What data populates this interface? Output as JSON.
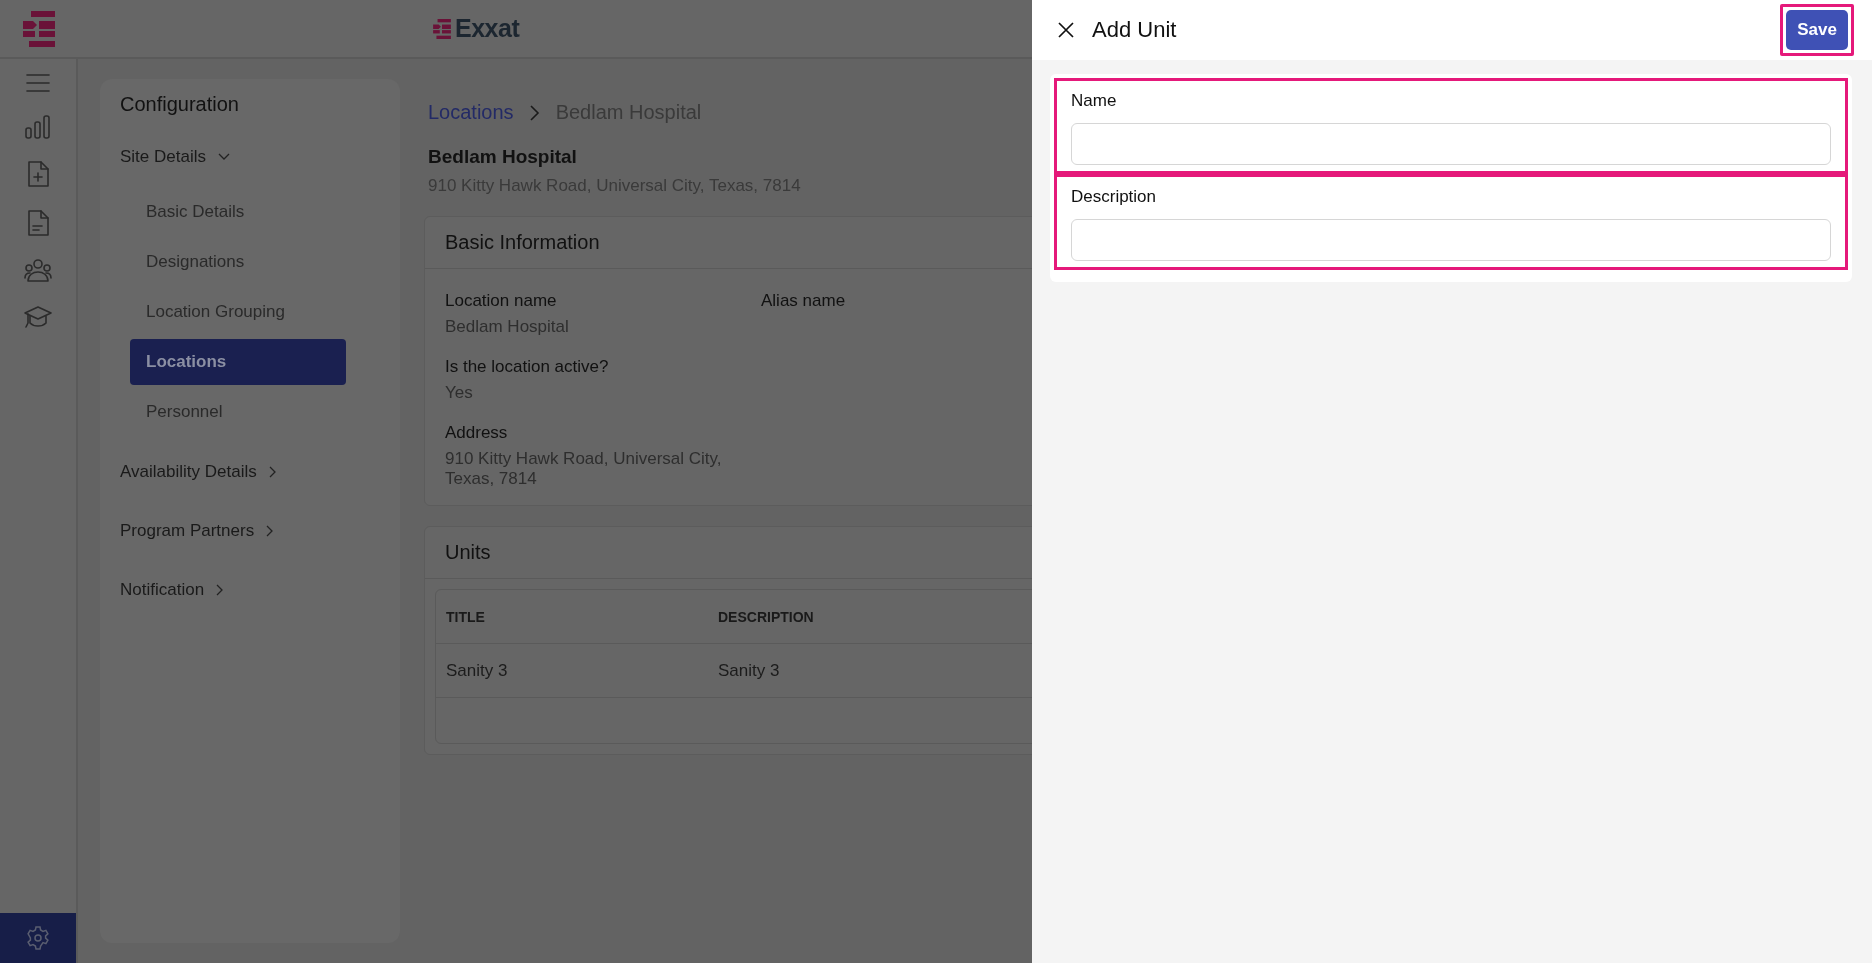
{
  "app": {
    "brand": "Exxat"
  },
  "rail": {
    "settings": {
      "selected": true
    }
  },
  "configuration": {
    "title": "Configuration",
    "sections": [
      {
        "label": "Site Details",
        "expanded": true,
        "children": [
          {
            "label": "Basic Details",
            "selected": false
          },
          {
            "label": "Designations",
            "selected": false
          },
          {
            "label": "Location Grouping",
            "selected": false
          },
          {
            "label": "Locations",
            "selected": true
          },
          {
            "label": "Personnel",
            "selected": false
          }
        ]
      },
      {
        "label": "Availability Details",
        "expanded": false
      },
      {
        "label": "Program Partners",
        "expanded": false
      },
      {
        "label": "Notification",
        "expanded": false
      }
    ]
  },
  "breadcrumb": [
    "Locations",
    "Bedlam Hospital"
  ],
  "location": {
    "name": "Bedlam Hospital",
    "address": "910 Kitty Hawk Road, Universal City, Texas, 7814"
  },
  "basic_information": {
    "title": "Basic Information",
    "rows": [
      [
        {
          "label": "Location name",
          "value": "Bedlam Hospital"
        },
        {
          "label": "Alias name"
        }
      ],
      [
        {
          "label": "Is the location active?",
          "value": "Yes"
        }
      ],
      [
        {
          "label": "Address",
          "value": "910 Kitty Hawk Road, Universal City, Texas, 7814"
        }
      ]
    ]
  },
  "units": {
    "title": "Units",
    "columns": [
      "TITLE",
      "DESCRIPTION"
    ],
    "rows": [
      [
        "Sanity 3",
        "Sanity 3"
      ]
    ]
  },
  "drawer": {
    "title": "Add Unit",
    "save": {
      "label": "Save",
      "highlighted": true
    },
    "fields": [
      {
        "label": "Name",
        "highlighted": true
      },
      {
        "label": "Description",
        "highlighted": true
      }
    ]
  }
}
